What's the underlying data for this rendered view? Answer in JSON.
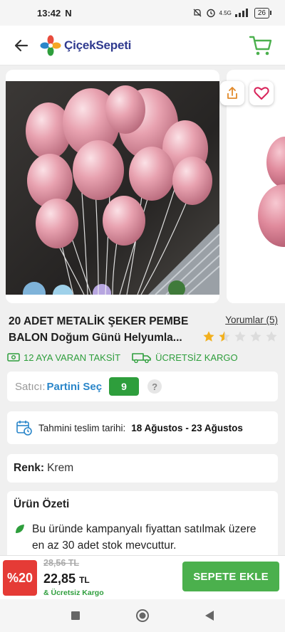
{
  "status_bar": {
    "time": "13:42",
    "network": "4.5G",
    "battery": "26"
  },
  "header": {
    "logo_text": "ÇiçekSepeti",
    "icons": {
      "back": "arrow-left-icon",
      "cart": "cart-icon"
    }
  },
  "product": {
    "title": "20 ADET METALİK ŞEKER PEMBE BALON Doğum Günü Helyumla...",
    "reviews_label": "Yorumlar (5)",
    "rating": 1.5,
    "rating_max": 5,
    "icons": {
      "share": "share-icon",
      "favorite": "heart-icon"
    }
  },
  "promos": {
    "installment": "12 AYA VARAN TAKSİT",
    "free_shipping": "ÜCRETSİZ KARGO"
  },
  "seller": {
    "label": "Satıcı:",
    "name": "Partini Seç",
    "score": "9",
    "help": "?"
  },
  "delivery": {
    "label": "Tahmini teslim tarihi:",
    "date_range": "18 Ağustos - 23 Ağustos"
  },
  "color": {
    "label": "Renk:",
    "value": "Krem"
  },
  "summary": {
    "title": "Ürün Özeti",
    "items": [
      "Bu üründe kampanyalı fiyattan satılmak üzere en az 30 adet stok mevcuttur."
    ]
  },
  "purchase": {
    "discount": "%20",
    "old_price": "28,56 TL",
    "new_price": "22,85",
    "currency": "TL",
    "free_cargo": "& Ücretsiz Kargo",
    "add_to_cart": "SEPETE EKLE"
  },
  "colors": {
    "brand_blue": "#2f3a8f",
    "green": "#2e9e3c",
    "button_green": "#4bb04d",
    "discount_red": "#e53b36",
    "link_blue": "#2a86c9",
    "star_gold": "#f2b01e"
  }
}
